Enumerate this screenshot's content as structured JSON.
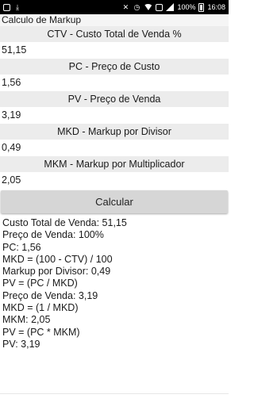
{
  "status_bar": {
    "battery_percent": "100%",
    "time": "16:08",
    "left_icons": [
      "image-icon",
      "download-icon"
    ],
    "right_icons": [
      "mute-icon",
      "alarm-icon",
      "wifi-icon",
      "sim-icon",
      "signal-icon",
      "battery-icon"
    ]
  },
  "app": {
    "title": "Calculo de Markup"
  },
  "fields": [
    {
      "label": "CTV - Custo Total de Venda %",
      "value": "51,15"
    },
    {
      "label": "PC - Preço de Custo",
      "value": "1,56"
    },
    {
      "label": "PV - Preço de Venda",
      "value": "3,19"
    },
    {
      "label": "MKD - Markup por Divisor",
      "value": "0,49"
    },
    {
      "label": "MKM - Markup por Multiplicador",
      "value": "2,05"
    }
  ],
  "calculate_button": "Calcular",
  "results": [
    "Custo Total de Venda: 51,15",
    "Preço de Venda: 100%",
    "PC: 1,56",
    "MKD = (100 - CTV) / 100",
    "Markup por Divisor: 0,49",
    "PV = (PC / MKD)",
    "Preço de Venda: 3,19",
    "MKD = (1 / MKD)",
    "MKM: 2,05",
    "PV = (PC * MKM)",
    "PV: 3,19"
  ]
}
